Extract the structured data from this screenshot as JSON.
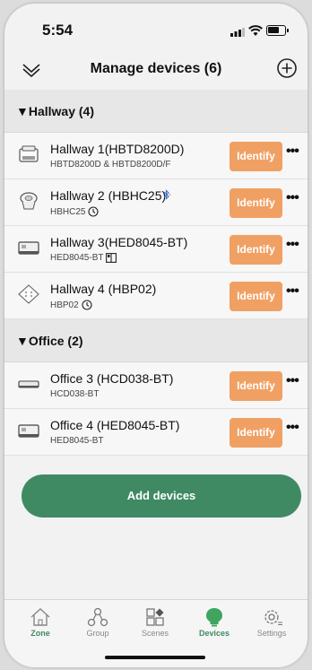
{
  "status": {
    "time": "5:54"
  },
  "header": {
    "title": "Manage devices (6)",
    "collapse_icon": "double-chevron-down-icon",
    "add_icon": "plus-circle-icon"
  },
  "sections": [
    {
      "label": "▼Hallway (4)",
      "devices": [
        {
          "name": "Hallway 1(HBTD8200D)",
          "sub": "HBTD8200D & HBTD8200D/F",
          "badge": "",
          "icon": "wall-module-icon",
          "identify": "Identify"
        },
        {
          "name": "Hallway 2 (HBHC25)",
          "sub": "HBHC25",
          "badge": "clock-icon",
          "icon": "sensor-icon",
          "identify": "Identify"
        },
        {
          "name": "Hallway 3(HED8045-BT)",
          "sub": "HED8045-BT",
          "badge": "panel-icon",
          "icon": "din-rail-module-icon",
          "identify": "Identify"
        },
        {
          "name": "Hallway 4 (HBP02)",
          "sub": "HBP02",
          "badge": "clock-icon",
          "icon": "push-button-icon",
          "identify": "Identify"
        }
      ]
    },
    {
      "label": "▼Office (2)",
      "devices": [
        {
          "name": "Office 3 (HCD038-BT)",
          "sub": "HCD038-BT",
          "badge": "",
          "icon": "flat-module-icon",
          "identify": "Identify"
        },
        {
          "name": "Office 4 (HED8045-BT)",
          "sub": "HED8045-BT",
          "badge": "",
          "icon": "din-rail-module-icon",
          "identify": "Identify"
        }
      ]
    }
  ],
  "add_devices_label": "Add devices",
  "tabs": [
    {
      "label": "Zone",
      "icon": "house-icon"
    },
    {
      "label": "Group",
      "icon": "group-icon"
    },
    {
      "label": "Scenes",
      "icon": "scenes-icon"
    },
    {
      "label": "Devices",
      "icon": "bulb-icon"
    },
    {
      "label": "Settings",
      "icon": "gear-icon"
    }
  ],
  "colors": {
    "accent_green": "#3f8a63",
    "identify_orange": "#f1a064",
    "section_bg": "#e7e7e7"
  }
}
